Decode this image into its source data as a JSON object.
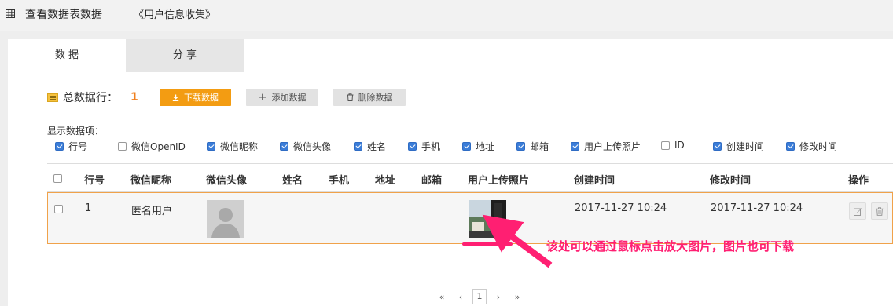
{
  "header": {
    "title": "查看数据表数据",
    "subtitle": "《用户信息收集》"
  },
  "tabs": [
    {
      "label": "数 据",
      "active": true
    },
    {
      "label": "分 享",
      "active": false
    }
  ],
  "summary": {
    "label": "总数据行：",
    "count": "1"
  },
  "toolbar": {
    "download_label": "下载数据",
    "add_label": "添加数据",
    "delete_label": "删除数据"
  },
  "columns_section": {
    "label": "显示数据项：",
    "items": [
      {
        "label": "行号",
        "checked": true
      },
      {
        "label": "微信OpenID",
        "checked": false
      },
      {
        "label": "微信昵称",
        "checked": true
      },
      {
        "label": "微信头像",
        "checked": true
      },
      {
        "label": "姓名",
        "checked": true
      },
      {
        "label": "手机",
        "checked": true
      },
      {
        "label": "地址",
        "checked": true
      },
      {
        "label": "邮箱",
        "checked": true
      },
      {
        "label": "用户上传照片",
        "checked": true
      },
      {
        "label": "ID",
        "checked": false
      },
      {
        "label": "创建时间",
        "checked": true
      },
      {
        "label": "修改时间",
        "checked": true
      }
    ]
  },
  "table": {
    "headers": [
      "行号",
      "微信昵称",
      "微信头像",
      "姓名",
      "手机",
      "地址",
      "邮箱",
      "用户上传照片",
      "创建时间",
      "修改时间",
      "操作"
    ],
    "rows": [
      {
        "row_no": "1",
        "nickname": "匿名用户",
        "created": "2017-11-27 10:24",
        "modified": "2017-11-27 10:24"
      }
    ]
  },
  "pagination": {
    "first": "«",
    "prev": "‹",
    "current": "1",
    "next": "›",
    "last": "»"
  },
  "annotation": {
    "text": "该处可以通过鼠标点击放大图片，图片也可下载",
    "color": "#ff1f72"
  },
  "colors": {
    "accent": "#f39c12",
    "count": "#f0801e",
    "checkbox": "#3b7dd8",
    "highlight_border": "#f0a24a"
  }
}
